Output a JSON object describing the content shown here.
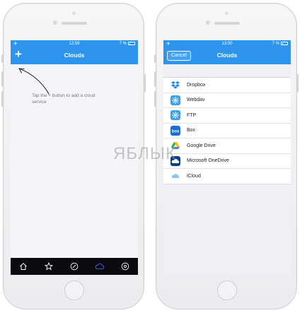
{
  "left_screen": {
    "status": {
      "time": "12:59",
      "battery": "7 %"
    },
    "nav": {
      "title": "Clouds",
      "add_label": "+"
    },
    "hint": "Tap the + button to add a cloud service",
    "tabs": [
      "home-icon",
      "star-icon",
      "compass-icon",
      "cloud-icon",
      "settings-icon"
    ],
    "active_tab_color": "#3a5bd9"
  },
  "right_screen": {
    "status": {
      "time": "13:00",
      "battery": "7 %"
    },
    "nav": {
      "title": "Clouds",
      "cancel_label": "Cancel"
    },
    "services": [
      {
        "label": "Dropbox",
        "icon": "dropbox-icon",
        "color": "#1e88e5"
      },
      {
        "label": "Webdav",
        "icon": "webdav-icon",
        "color": "#3aa1e8"
      },
      {
        "label": "FTP",
        "icon": "ftp-icon",
        "color": "#3aa1e8"
      },
      {
        "label": "Box",
        "icon": "box-icon",
        "color": "#1b6fd0"
      },
      {
        "label": "Google Drive",
        "icon": "google-drive-icon",
        "color": "#34a853"
      },
      {
        "label": "Microsoft OneDrive",
        "icon": "onedrive-icon",
        "color": "#0a3f8f"
      },
      {
        "label": "iCloud",
        "icon": "icloud-icon",
        "color": "#8ec5f5"
      }
    ]
  },
  "watermark": "ЯБЛЫК",
  "colors": {
    "primary": "#2e95ef",
    "tabbar": "#0b0b0d"
  }
}
